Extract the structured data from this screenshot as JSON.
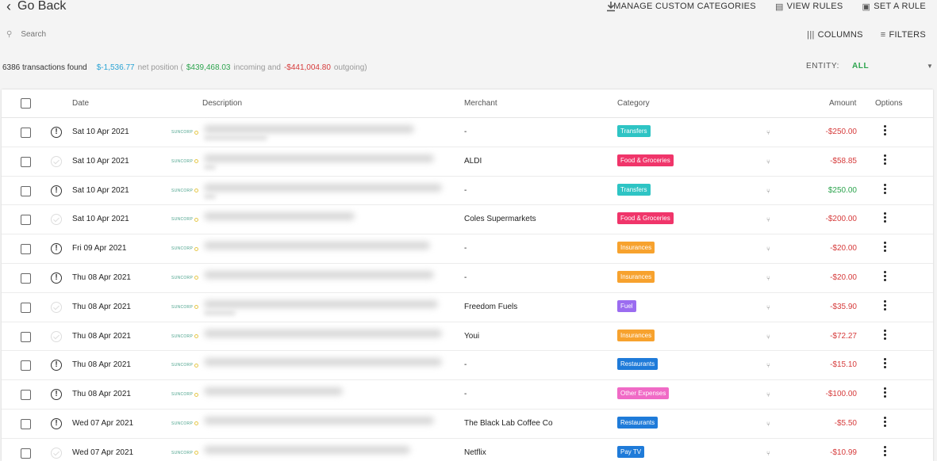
{
  "header": {
    "go_back": "Go Back",
    "manage_categories": "MANAGE CUSTOM CATEGORIES",
    "view_rules": "VIEW RULES",
    "set_rule": "SET A RULE",
    "columns": "COLUMNS",
    "filters": "FILTERS"
  },
  "search": {
    "placeholder": "Search"
  },
  "summary": {
    "count": "6386 transactions found",
    "net": "$-1,536.77",
    "net_label": "net position (",
    "incoming": "$439,468.03",
    "incoming_label": "incoming and",
    "outgoing": "-$441,004.80",
    "outgoing_label": "outgoing)"
  },
  "entity": {
    "label": "ENTITY:",
    "value": "ALL"
  },
  "table": {
    "headers": {
      "date": "Date",
      "description": "Description",
      "merchant": "Merchant",
      "category": "Category",
      "amount": "Amount",
      "options": "Options"
    },
    "bank_label": "SUNCORP",
    "rows": [
      {
        "status": "alert",
        "date": "Sat 10 Apr 2021",
        "merchant": "-",
        "category": "Transfers",
        "cat_color": "#2ec4c4",
        "amount": "-$250.00",
        "sign": "neg"
      },
      {
        "status": "ok",
        "date": "Sat 10 Apr 2021",
        "merchant": "ALDI",
        "category": "Food & Groceries",
        "cat_color": "#f0356a",
        "amount": "-$58.85",
        "sign": "neg"
      },
      {
        "status": "alert",
        "date": "Sat 10 Apr 2021",
        "merchant": "-",
        "category": "Transfers",
        "cat_color": "#2ec4c4",
        "amount": "$250.00",
        "sign": "pos"
      },
      {
        "status": "ok",
        "date": "Sat 10 Apr 2021",
        "merchant": "Coles Supermarkets",
        "category": "Food & Groceries",
        "cat_color": "#f0356a",
        "amount": "-$200.00",
        "sign": "neg"
      },
      {
        "status": "alert",
        "date": "Fri 09 Apr 2021",
        "merchant": "-",
        "category": "Insurances",
        "cat_color": "#f7a22e",
        "amount": "-$20.00",
        "sign": "neg"
      },
      {
        "status": "alert",
        "date": "Thu 08 Apr 2021",
        "merchant": "-",
        "category": "Insurances",
        "cat_color": "#f7a22e",
        "amount": "-$20.00",
        "sign": "neg"
      },
      {
        "status": "ok",
        "date": "Thu 08 Apr 2021",
        "merchant": "Freedom Fuels",
        "category": "Fuel",
        "cat_color": "#9b6cf0",
        "amount": "-$35.90",
        "sign": "neg"
      },
      {
        "status": "ok",
        "date": "Thu 08 Apr 2021",
        "merchant": "Youi",
        "category": "Insurances",
        "cat_color": "#f7a22e",
        "amount": "-$72.27",
        "sign": "neg"
      },
      {
        "status": "alert",
        "date": "Thu 08 Apr 2021",
        "merchant": "-",
        "category": "Restaurants",
        "cat_color": "#1f7bd9",
        "amount": "-$15.10",
        "sign": "neg"
      },
      {
        "status": "alert",
        "date": "Thu 08 Apr 2021",
        "merchant": "-",
        "category": "Other Expenses",
        "cat_color": "#f06ac6",
        "amount": "-$100.00",
        "sign": "neg"
      },
      {
        "status": "alert",
        "date": "Wed 07 Apr 2021",
        "merchant": "The Black Lab Coffee Co",
        "category": "Restaurants",
        "cat_color": "#1f7bd9",
        "amount": "-$5.50",
        "sign": "neg"
      },
      {
        "status": "ok",
        "date": "Wed 07 Apr 2021",
        "merchant": "Netflix",
        "category": "Pay TV",
        "cat_color": "#1f7bd9",
        "amount": "-$10.99",
        "sign": "neg"
      }
    ]
  }
}
